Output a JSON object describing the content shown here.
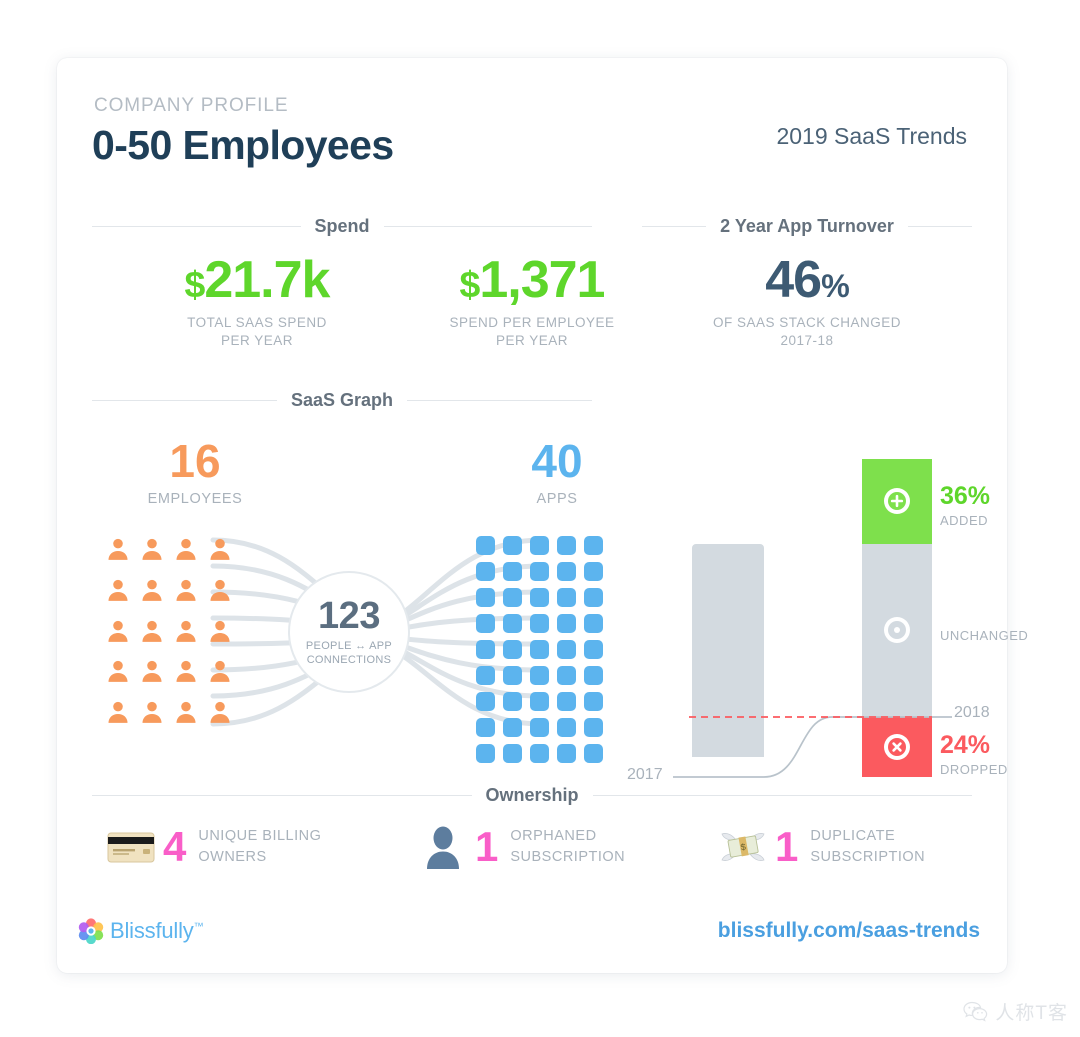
{
  "header": {
    "eyebrow": "COMPANY PROFILE",
    "title": "0-50 Employees",
    "report": "2019 SaaS Trends"
  },
  "spend": {
    "section_label": "Spend",
    "stats": [
      {
        "currency": "$",
        "value": "21.7k",
        "caption_line1": "TOTAL SAAS SPEND",
        "caption_line2": "PER YEAR"
      },
      {
        "currency": "$",
        "value": "1,371",
        "caption_line1": "SPEND PER EMPLOYEE",
        "caption_line2": "PER YEAR"
      }
    ]
  },
  "turnover": {
    "section_label": "2 Year App Turnover",
    "value": "46",
    "pct": "%",
    "caption_line1": "OF SAAS STACK CHANGED",
    "caption_line2": "2017-18"
  },
  "saas_graph": {
    "section_label": "SaaS Graph",
    "employees": {
      "value": "16",
      "label": "EMPLOYEES"
    },
    "apps": {
      "value": "40",
      "label": "APPS"
    },
    "hub": {
      "value": "123",
      "caption_line1": "PEOPLE ↔ APP",
      "caption_line2": "CONNECTIONS"
    },
    "people_icon_count": 20,
    "app_icon_count": 45
  },
  "ownership": {
    "section_label": "Ownership",
    "items": [
      {
        "icon": "credit-card-icon",
        "value": "4",
        "caption_line1": "UNIQUE BILLING",
        "caption_line2": "OWNERS"
      },
      {
        "icon": "person-silhouette-icon",
        "value": "1",
        "caption_line1": "ORPHANED",
        "caption_line2": "SUBSCRIPTION"
      },
      {
        "icon": "money-with-wings-icon",
        "value": "1",
        "caption_line1": "DUPLICATE",
        "caption_line2": "SUBSCRIPTION"
      }
    ]
  },
  "footer": {
    "logo_name": "Blissfully",
    "logo_tm": "™",
    "url": "blissfully.com/saas-trends"
  },
  "watermark": {
    "text": "人称T客"
  },
  "colors": {
    "green": "#5ed62b",
    "bar_green": "#7ee04c",
    "red": "#fb5a5f",
    "orange": "#f79a5c",
    "blue": "#5cb4ee",
    "pink": "#f95ec8",
    "dark_blue": "#1f3f58",
    "gray": "#d3dae0",
    "muted_text": "#a9b2bb"
  },
  "chart_data": {
    "type": "bar",
    "title": "2 Year App Turnover",
    "subtitle": "OF SAAS STACK CHANGED 2017-18",
    "categories": [
      "2017",
      "2018"
    ],
    "stacked": true,
    "series": [
      {
        "name": "ADDED",
        "values": [
          0,
          36
        ],
        "unit": "%",
        "color": "#7ee04c"
      },
      {
        "name": "UNCHANGED",
        "values": [
          76,
          76
        ],
        "unit": "%",
        "color": "#d3dae0"
      },
      {
        "name": "DROPPED",
        "values": [
          24,
          0
        ],
        "unit": "%",
        "color": "#fb5a5f"
      }
    ],
    "annotations": [
      {
        "text": "36%",
        "label": "ADDED",
        "color": "#5ed62b"
      },
      {
        "text": "UNCHANGED",
        "color": "#a9b2bb"
      },
      {
        "text": "24%",
        "label": "DROPPED",
        "color": "#fb5a5f"
      },
      {
        "text": "2017",
        "color": "#a9b2bb"
      },
      {
        "text": "2018",
        "color": "#a9b2bb"
      }
    ],
    "total_turnover_pct": 46,
    "grid": false,
    "legend": "inline-right"
  }
}
